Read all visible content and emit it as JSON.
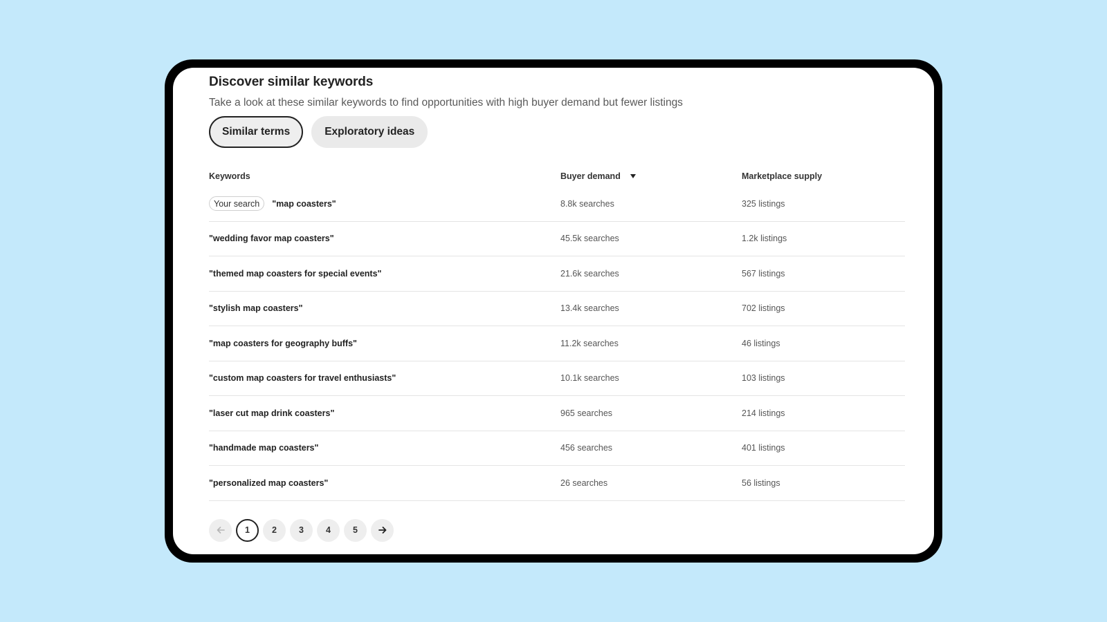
{
  "section": {
    "title": "Discover similar keywords",
    "subtitle": "Take a look at these similar keywords to find opportunities with high buyer demand but fewer listings"
  },
  "tabs": [
    {
      "label": "Similar terms",
      "active": true
    },
    {
      "label": "Exploratory ideas",
      "active": false
    }
  ],
  "table": {
    "headers": {
      "keywords": "Keywords",
      "buyer_demand": "Buyer demand",
      "marketplace_supply": "Marketplace supply"
    },
    "sort_icon": "caret-down-icon",
    "your_search_badge": "Your search",
    "rows": [
      {
        "keyword": "\"map coasters\"",
        "demand": "8.8k searches",
        "supply": "325 listings"
      },
      {
        "keyword": "\"wedding favor map coasters\"",
        "demand": "45.5k searches",
        "supply": "1.2k listings"
      },
      {
        "keyword": "\"themed map coasters for special events\"",
        "demand": "21.6k searches",
        "supply": "567 listings"
      },
      {
        "keyword": "\"stylish map coasters\"",
        "demand": "13.4k searches",
        "supply": "702 listings"
      },
      {
        "keyword": "\"map coasters for geography buffs\"",
        "demand": "11.2k searches",
        "supply": "46 listings"
      },
      {
        "keyword": "\"custom map coasters for travel enthusiasts\"",
        "demand": "10.1k searches",
        "supply": "103 listings"
      },
      {
        "keyword": "\"laser cut map drink coasters\"",
        "demand": "965 searches",
        "supply": "214 listings"
      },
      {
        "keyword": "\"handmade map coasters\"",
        "demand": "456 searches",
        "supply": "401 listings"
      },
      {
        "keyword": "\"personalized map coasters\"",
        "demand": "26 searches",
        "supply": "56 listings"
      }
    ]
  },
  "pagination": {
    "prev_icon": "arrow-left-icon",
    "next_icon": "arrow-right-icon",
    "pages": [
      "1",
      "2",
      "3",
      "4",
      "5"
    ],
    "current_page": "1"
  },
  "colors": {
    "background": "#c4e9fb",
    "device_frame": "#000000",
    "text": "#222222",
    "muted_text": "#595959"
  }
}
